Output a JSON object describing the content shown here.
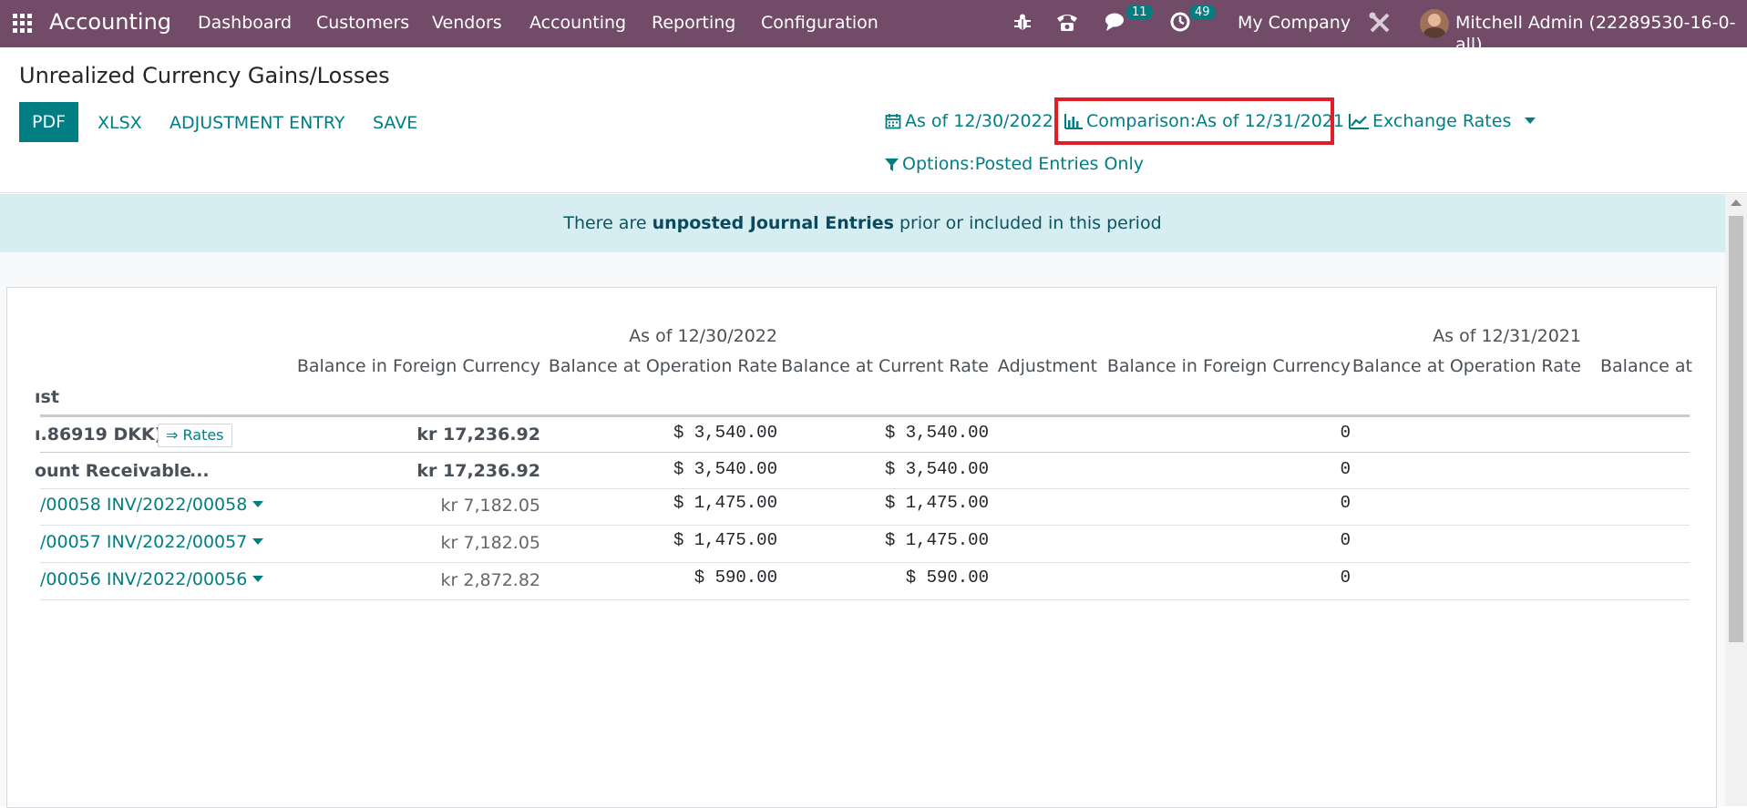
{
  "navbar": {
    "app_name": "Accounting",
    "menu": [
      "Dashboard",
      "Customers",
      "Vendors",
      "Accounting",
      "Reporting",
      "Configuration"
    ],
    "messages_count": "11",
    "activities_count": "49",
    "company": "My Company",
    "user": "Mitchell Admin (22289530-16-0-all)",
    "colors": {
      "navbar_bg": "#714b67",
      "accent": "#017e84",
      "highlight": "#e01e2a"
    }
  },
  "control_panel": {
    "title": "Unrealized Currency Gains/Losses",
    "buttons": {
      "pdf": "PDF",
      "xlsx": "XLSX",
      "adjustment": "ADJUSTMENT ENTRY",
      "save": "SAVE"
    },
    "filters": {
      "date": "As of 12/30/2022",
      "comparison": "Comparison:As of 12/31/2021",
      "exchange_rates": "Exchange Rates",
      "options": "Options:Posted Entries Only"
    }
  },
  "alert": {
    "prefix": "There are ",
    "link": "unposted Journal Entries",
    "suffix": " prior or included in this period"
  },
  "report": {
    "period_headers": [
      "As of 12/30/2022",
      "As of 12/31/2021"
    ],
    "columns": [
      "Balance in Foreign Currency",
      "Balance at Operation Rate",
      "Balance at Current Rate",
      "Adjustment",
      "Balance in Foreign Currency",
      "Balance at Operation Rate",
      "Balance at"
    ],
    "name_header": "ıst",
    "rates_button": "⇒ Rates",
    "rows": [
      {
        "name": "ı.86919 DKK)",
        "foreign": "kr 17,236.92",
        "op_rate": "$ 3,540.00",
        "cur_rate": "$ 3,540.00",
        "comp_foreign": "0",
        "style": "currency"
      },
      {
        "name": "ount Receivable",
        "ellipsis": "...",
        "foreign": "kr 17,236.92",
        "op_rate": "$ 3,540.00",
        "cur_rate": "$ 3,540.00",
        "comp_foreign": "0",
        "style": "account"
      },
      {
        "name": "/00058 INV/2022/00058",
        "foreign": "kr 7,182.05",
        "op_rate": "$ 1,475.00",
        "cur_rate": "$ 1,475.00",
        "comp_foreign": "0",
        "style": "line"
      },
      {
        "name": "/00057 INV/2022/00057",
        "foreign": "kr 7,182.05",
        "op_rate": "$ 1,475.00",
        "cur_rate": "$ 1,475.00",
        "comp_foreign": "0",
        "style": "line"
      },
      {
        "name": "/00056 INV/2022/00056",
        "foreign": "kr 2,872.82",
        "op_rate": "$ 590.00",
        "cur_rate": "$ 590.00",
        "comp_foreign": "0",
        "style": "line"
      }
    ]
  }
}
